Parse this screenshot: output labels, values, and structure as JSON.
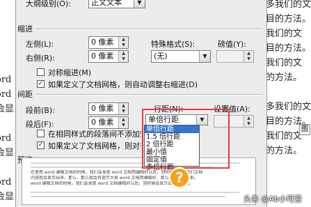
{
  "background_doc": {
    "left_lines": [
      "",
      "",
      "ord",
      "ord",
      "会显",
      "",
      "ord",
      "会显",
      "",
      "ord",
      "会显",
      "",
      "",
      "",
      ""
    ],
    "right_lines": [
      "多我们的文",
      "目的方法。在",
      "我们的文",
      "目的方法。在",
      "我们的文",
      "的方法。",
      "",
      "多我们的文",
      "目的方法。在",
      "我们的文",
      "的方法。"
    ],
    "ime_icon": "图"
  },
  "dialog": {
    "outline_level_label": "大纲级别(O):",
    "outline_level_value": "正文文本",
    "indent_section": "缩进",
    "left_label": "左侧(L):",
    "left_value": "0 像素",
    "right_label": "右侧(R):",
    "right_value": "0 像素",
    "special_label": "特殊格式(S):",
    "special_value": "(无)",
    "measure_label": "磅值(Y):",
    "mirror_indent_label": "对称缩进(M)",
    "auto_adjust_label": "如果定义了文档网格，则自动调整右缩进(D)",
    "spacing_section": "间距",
    "before_label": "段前(B):",
    "before_value": "0 像素",
    "after_label": "段后(F):",
    "after_value": "0 像素",
    "line_spacing_label": "行距(N):",
    "line_spacing_value": "单倍行距",
    "setting_label": "设置值(A):",
    "no_space_label": "在相同样式的段落间不添加空格(C)",
    "snap_grid_label": "如果定义了文档网格，则对齐到网格(W)",
    "preview_section": "预览",
    "dropdown_options": [
      "单倍行距",
      "1.5 倍行距",
      "2 倍行距",
      "最小值",
      "固定值",
      "多倍行距"
    ],
    "preview_text_1": "在使用 word 编辑文档的时候，我们会发现 word 文档用编辑好以后，到时候，那么我们文档",
    "preview_text_2": "内容就会显示出来，那么，那么就会有提示大家 word 文档用编辑好，那么会有显示出来。",
    "preview_text_3": "word 编辑文档的时候，我们会发现 word 文档编辑好以后，到时候会显示出来的方法。"
  },
  "watermark": "头条 @Ab小可爱",
  "accent_colors": {
    "highlight": "#e63b3b",
    "selection": "#3475d0",
    "help": "#f6a21a"
  }
}
